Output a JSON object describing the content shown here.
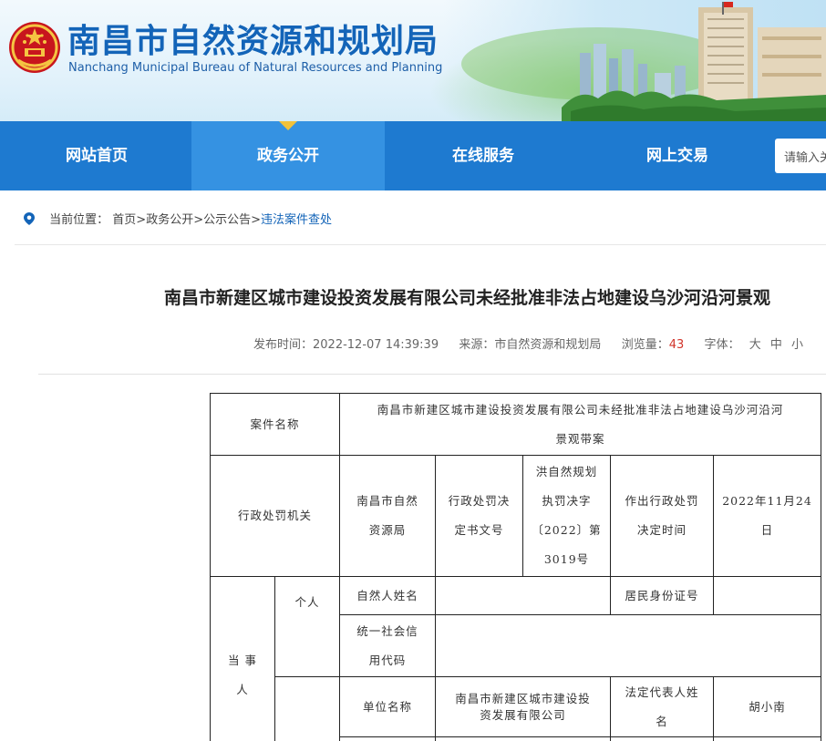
{
  "header": {
    "title": "南昌市自然资源和规划局",
    "subtitle": "Nanchang Municipal Bureau of Natural Resources and Planning"
  },
  "nav": {
    "items": [
      {
        "label": "网站首页"
      },
      {
        "label": "政务公开"
      },
      {
        "label": "在线服务"
      },
      {
        "label": "网上交易"
      }
    ],
    "active_index": 1,
    "search_placeholder": "请输入关"
  },
  "breadcrumb": {
    "prefix": "当前位置：",
    "path": "首页>政务公开>公示公告>",
    "current": "违法案件查处"
  },
  "article": {
    "title": "南昌市新建区城市建设投资发展有限公司未经批准非法占地建设乌沙河沿河景观",
    "publish_label": "发布时间：",
    "publish_time": "2022-12-07 14:39:39",
    "source_label": "来源：",
    "source": "市自然资源和规划局",
    "views_label": "浏览量：",
    "views": "43",
    "font_label": "字体：",
    "font_sizes": [
      "大",
      "中",
      "小"
    ]
  },
  "case_table": {
    "case_name_label": "案件名称",
    "case_name_line1": "南昌市新建区城市建设投资发展有限公司未经批准非法占地建设乌沙河沿河",
    "case_name_line2": "景观带案",
    "authority_label": "行政处罚机关",
    "authority_value": [
      "南昌市自然",
      "资源局"
    ],
    "doc_no_label": [
      "行政处罚决",
      "定书文号"
    ],
    "doc_no_value": [
      "洪自然规划",
      "执罚决字",
      "〔2022〕第",
      "3019号"
    ],
    "decision_time_label": [
      "作出行政处罚",
      "决定时间"
    ],
    "decision_time_value": [
      "2022年11月24",
      "日"
    ],
    "party_label": [
      "当 事",
      "人"
    ],
    "individual_label": "个人",
    "natural_person_label": "自然人姓名",
    "id_number_label": "居民身份证号",
    "credit_code_label": [
      "统一社会信",
      "用代码"
    ],
    "unit_name_label": "单位名称",
    "unit_name_value": [
      "南昌市新建区城市建设投",
      "资发展有限公司"
    ],
    "legal_rep_label": [
      "法定代表人姓",
      "名"
    ],
    "legal_rep_value": "胡小南"
  }
}
